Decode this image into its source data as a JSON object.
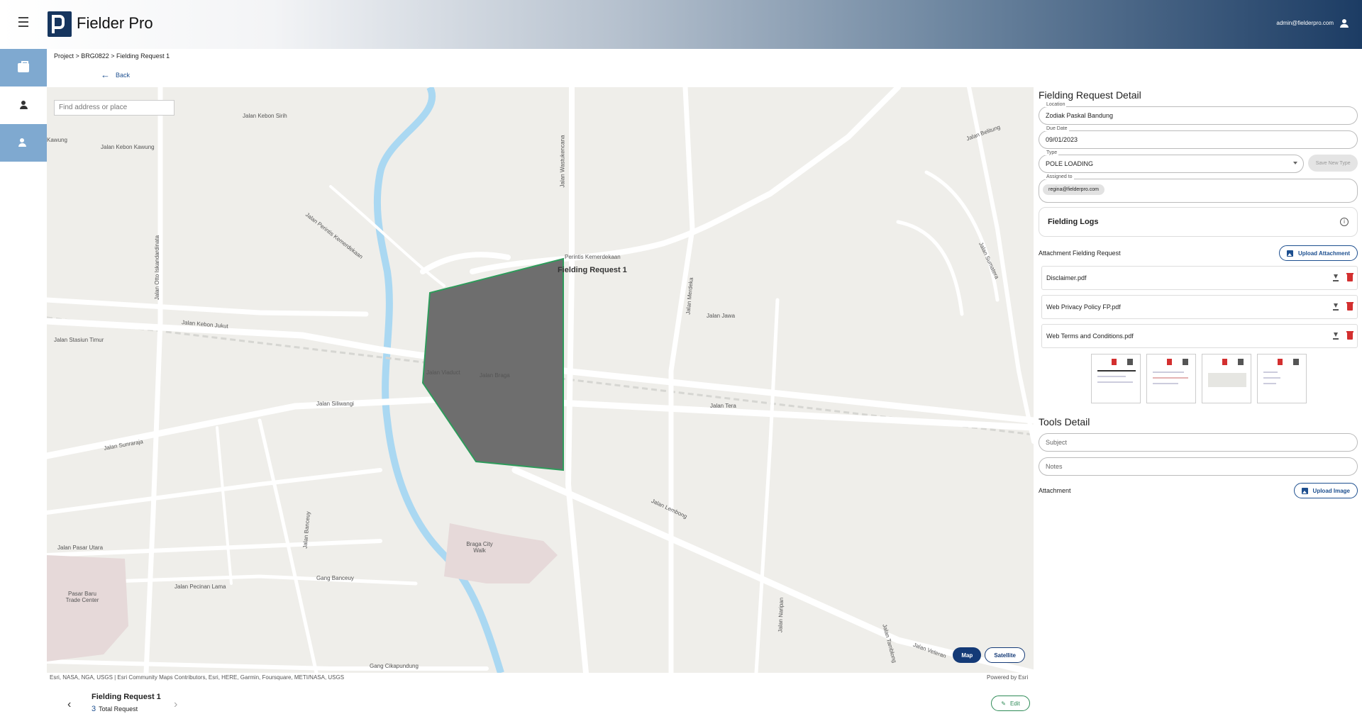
{
  "header": {
    "app_title": "Fielder Pro",
    "user_email": "admin@fielderpro.com"
  },
  "sidebar": {
    "items": [
      {
        "icon": "briefcase-icon",
        "active": true
      },
      {
        "icon": "person-add-icon",
        "active": false
      },
      {
        "icon": "people-icon",
        "active": true
      }
    ]
  },
  "breadcrumb": "Project > BRG0822 > Fielding Request 1",
  "back_label": "Back",
  "map": {
    "search_placeholder": "Find address or place",
    "polygon_label": "Fielding Request 1",
    "labels": [
      {
        "text": "Jalan Kebon Sirih"
      },
      {
        "text": "Jalan Kebon Kawung"
      },
      {
        "text": "Kawung"
      },
      {
        "text": "Jalan Otto Iskandardinata"
      },
      {
        "text": "Jalan Perintis Kemerdekaan"
      },
      {
        "text": "Jalan Wastukencana"
      },
      {
        "text": "Perintis Kemerdekaan"
      },
      {
        "text": "Jalan Kebon Jukut"
      },
      {
        "text": "Jalan Stasiun Timur"
      },
      {
        "text": "Jalan Viaduct"
      },
      {
        "text": "Jalan Braga"
      },
      {
        "text": "Jalan Siliwangi"
      },
      {
        "text": "Jalan Sunraraja"
      },
      {
        "text": "Jalan Merdeka"
      },
      {
        "text": "Jalan Jawa"
      },
      {
        "text": "Jalan Tera"
      },
      {
        "text": "Jalan Lembong"
      },
      {
        "text": "Jalan Pasar Utara"
      },
      {
        "text": "Jalan Pecinan Lama"
      },
      {
        "text": "Gang Banceuy"
      },
      {
        "text": "Gang Cikapundung"
      },
      {
        "text": "Braga City Walk"
      },
      {
        "text": "Pasar Baru Trade Center"
      },
      {
        "text": "Jalan Belitung"
      },
      {
        "text": "Jalan Sumatera"
      },
      {
        "text": "Jalan Veteran"
      },
      {
        "text": "Jalan Tamblong"
      },
      {
        "text": "Jalan Naripan"
      },
      {
        "text": "Jalan Banceuy"
      }
    ],
    "mode_buttons": {
      "map": "Map",
      "satellite": "Satellite"
    },
    "active_mode": "Map",
    "attribution": "Esri, NASA, NGA, USGS | Esri Community Maps Contributors, Esri, HERE, Garmin, Foursquare, METI/NASA, USGS",
    "powered_by": "Powered by Esri"
  },
  "bottom": {
    "request_title": "Fielding Request 1",
    "total_count": "3",
    "total_label": "Total Request",
    "edit_label": "Edit"
  },
  "detail": {
    "title": "Fielding Request Detail",
    "location_label": "Location",
    "location_value": "Zodiak Paskal Bandung",
    "due_date_label": "Due Date",
    "due_date_value": "09/01/2023",
    "type_label": "Type",
    "type_value": "POLE LOADING",
    "save_type_label": "Save New Type",
    "assigned_label": "Assigned to",
    "assigned_value": "regina@fielderpro.com",
    "logs_label": "Fielding Logs",
    "attachment_heading": "Attachment Fielding Request",
    "upload_attachment_label": "Upload Attachment",
    "files": [
      {
        "name": "Disclaimer.pdf"
      },
      {
        "name": "Web Privacy Policy FP.pdf"
      },
      {
        "name": "Web Terms and Conditions.pdf"
      }
    ]
  },
  "tools": {
    "title": "Tools Detail",
    "subject_placeholder": "Subject",
    "notes_placeholder": "Notes",
    "attachment_label": "Attachment",
    "upload_image_label": "Upload Image"
  },
  "colors": {
    "brand": "#16355e",
    "accent": "#1d4f8f",
    "sidebar_active": "#7fa9d0",
    "polygon_fill": "#6e6e6e",
    "polygon_stroke": "#2e9b5b",
    "delete": "#d32f2f"
  }
}
